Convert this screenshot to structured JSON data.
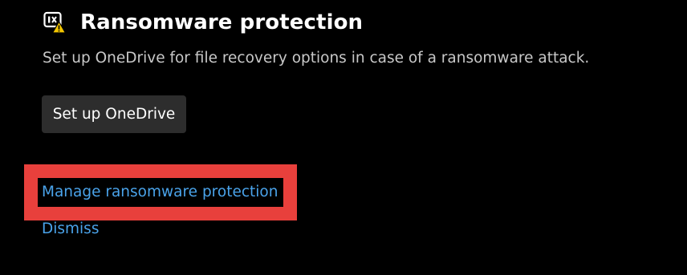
{
  "section": {
    "title": "Ransomware protection",
    "description": "Set up OneDrive for file recovery options in case of a ransomware attack.",
    "icon": "ransomware-warning-icon"
  },
  "actions": {
    "setup_button_label": "Set up OneDrive",
    "manage_link_label": "Manage ransomware protection",
    "dismiss_link_label": "Dismiss"
  },
  "colors": {
    "background": "#000000",
    "title_text": "#ffffff",
    "description_text": "#c8c8c8",
    "button_background": "#2d2d2d",
    "link": "#4aa3ea",
    "highlight": "#e8403c",
    "warning": "#f2c500"
  }
}
